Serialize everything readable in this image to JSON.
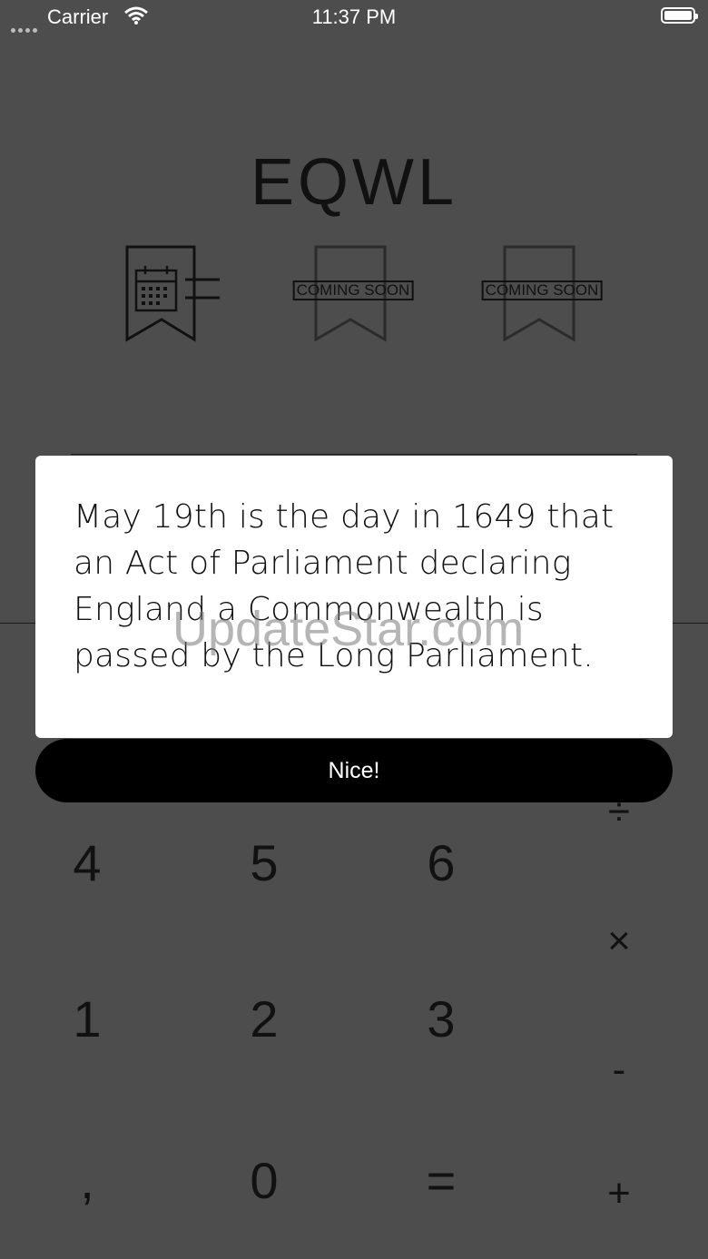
{
  "status_bar": {
    "carrier": "Carrier",
    "time": "11:37 PM"
  },
  "app": {
    "title": "EQWL"
  },
  "modes": [
    {
      "icon": "calendar-bookmark-icon",
      "label": ""
    },
    {
      "icon": "bookmark-icon",
      "label": "COMING SOON"
    },
    {
      "icon": "bookmark-icon",
      "label": "COMING SOON"
    }
  ],
  "keypad": {
    "row1": [
      "4",
      "5",
      "6"
    ],
    "row2": [
      "1",
      "2",
      "3"
    ],
    "row3": [
      ",",
      "0",
      "="
    ],
    "operators": [
      "÷",
      "×",
      "-",
      "+"
    ]
  },
  "dialog": {
    "message": "May 19th is the day in 1649 that an Act of Parliament declaring England a Commonwealth is passed by the Long Parliament.",
    "button_label": "Nice!"
  },
  "watermark": "UpdateStar.com",
  "colors": {
    "background": "#4d4d4d",
    "card": "#ffffff",
    "button": "#000000"
  }
}
